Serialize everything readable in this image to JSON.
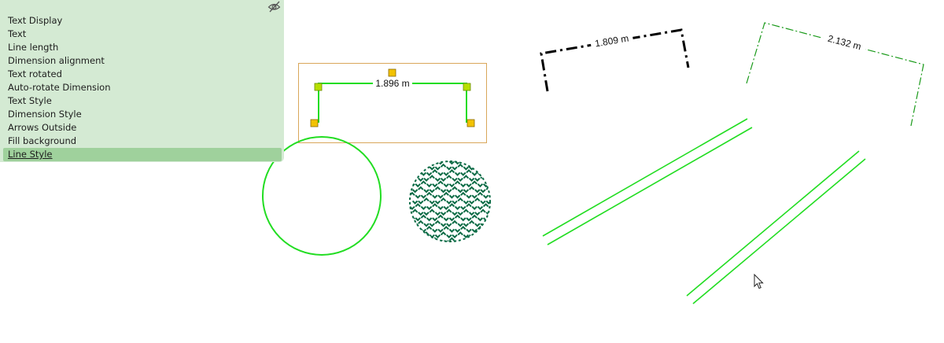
{
  "menu": {
    "hide_icon": "eye-slash-icon",
    "items": [
      {
        "label": "Text Display"
      },
      {
        "label": "Text"
      },
      {
        "label": "Line length"
      },
      {
        "label": "Dimension alignment"
      },
      {
        "label": "Text rotated"
      },
      {
        "label": "Auto-rotate Dimension"
      },
      {
        "label": "Text Style"
      },
      {
        "label": "Dimension Style"
      },
      {
        "label": "Arrows Outside"
      },
      {
        "label": "Fill background"
      },
      {
        "label": "Line Style",
        "active": true
      }
    ]
  },
  "canvas": {
    "dim_selected": "1.896 m",
    "dim_black": "1.809 m",
    "dim_green_dashdot": "2.132 m"
  },
  "colors": {
    "menu_bg": "#d4ead3",
    "menu_active": "#9fd19c",
    "line_green": "#22dd22",
    "hatch_green": "#0a6b45",
    "handle_yellow": "#f2c200",
    "selection_border": "#d9a75a"
  }
}
